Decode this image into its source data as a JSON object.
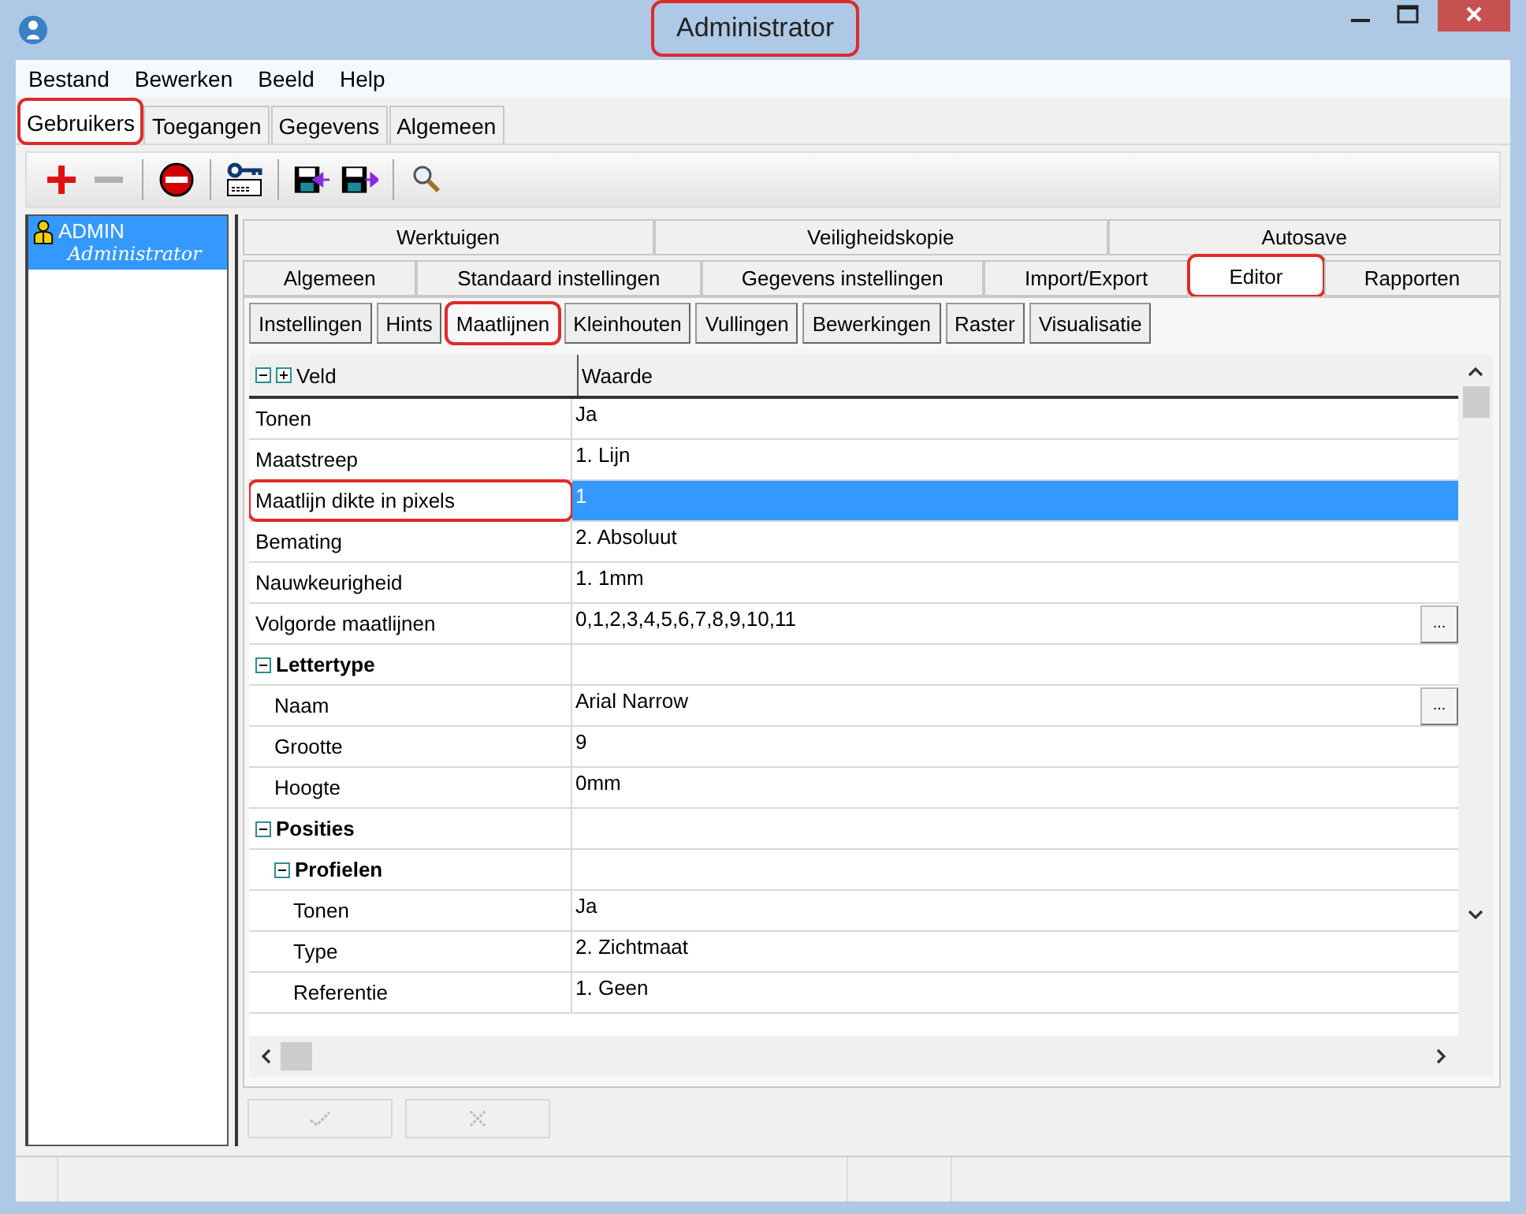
{
  "window": {
    "title": "Administrator",
    "title_highlighted": true
  },
  "menu": [
    "Bestand",
    "Bewerken",
    "Beeld",
    "Help"
  ],
  "top_tabs": [
    {
      "label": "Gebruikers",
      "selected": true,
      "highlighted": true
    },
    {
      "label": "Toegangen",
      "selected": false,
      "highlighted": false
    },
    {
      "label": "Gegevens",
      "selected": false,
      "highlighted": false
    },
    {
      "label": "Algemeen",
      "selected": false,
      "highlighted": false
    }
  ],
  "toolbar": [
    {
      "kind": "add",
      "disabled": false
    },
    {
      "kind": "remove",
      "disabled": true
    },
    {
      "kind": "sep"
    },
    {
      "kind": "block",
      "disabled": false
    },
    {
      "kind": "sep"
    },
    {
      "kind": "password",
      "disabled": false
    },
    {
      "kind": "sep"
    },
    {
      "kind": "import",
      "disabled": false
    },
    {
      "kind": "export",
      "disabled": false
    },
    {
      "kind": "sep"
    },
    {
      "kind": "search",
      "disabled": false
    }
  ],
  "users": [
    {
      "name": "ADMIN",
      "role": "Administrator",
      "selected": true
    }
  ],
  "settings_tabs": [
    [
      {
        "label": "Werktuigen",
        "selected": false,
        "highlighted": false
      },
      {
        "label": "Veiligheidskopie",
        "selected": false,
        "highlighted": false
      },
      {
        "label": "Autosave",
        "selected": false,
        "highlighted": false
      }
    ],
    [
      {
        "label": "Algemeen",
        "selected": false,
        "highlighted": false
      },
      {
        "label": "Standaard instellingen",
        "selected": false,
        "highlighted": false
      },
      {
        "label": "Gegevens instellingen",
        "selected": false,
        "highlighted": false
      },
      {
        "label": "Import/Export",
        "selected": false,
        "highlighted": false
      },
      {
        "label": "Editor",
        "selected": true,
        "highlighted": true
      },
      {
        "label": "Rapporten",
        "selected": false,
        "highlighted": false
      }
    ]
  ],
  "sub_tabs": [
    {
      "label": "Instellingen",
      "selected": false,
      "highlighted": false
    },
    {
      "label": "Hints",
      "selected": false,
      "highlighted": false
    },
    {
      "label": "Maatlijnen",
      "selected": true,
      "highlighted": true
    },
    {
      "label": "Kleinhouten",
      "selected": false,
      "highlighted": false
    },
    {
      "label": "Vullingen",
      "selected": false,
      "highlighted": false
    },
    {
      "label": "Bewerkingen",
      "selected": false,
      "highlighted": false
    },
    {
      "label": "Raster",
      "selected": false,
      "highlighted": false
    },
    {
      "label": "Visualisatie",
      "selected": false,
      "highlighted": false
    }
  ],
  "grid": {
    "columns": [
      "Veld",
      "Waarde"
    ],
    "rows": [
      {
        "kind": "field",
        "name": "Tonen",
        "value": "Ja",
        "selected": false,
        "highlighted": false
      },
      {
        "kind": "field",
        "name": "Maatstreep",
        "value": "1. Lijn",
        "selected": false,
        "highlighted": false
      },
      {
        "kind": "field",
        "name": "Maatlijn dikte in pixels",
        "value": "1",
        "selected": true,
        "highlighted": true
      },
      {
        "kind": "field",
        "name": "Bemating",
        "value": "2. Absoluut",
        "selected": false,
        "highlighted": false
      },
      {
        "kind": "field",
        "name": "Nauwkeurigheid",
        "value": "1. 1mm",
        "selected": false,
        "highlighted": false
      },
      {
        "kind": "field",
        "name": "Volgorde maatlijnen",
        "value": "0,1,2,3,4,5,6,7,8,9,10,11",
        "button": "...",
        "selected": false,
        "highlighted": false
      },
      {
        "kind": "group",
        "name": "Lettertype",
        "expanded": true,
        "children": [
          {
            "kind": "field",
            "name": "Naam",
            "value": "Arial Narrow",
            "button": "...",
            "selected": false,
            "highlighted": false
          },
          {
            "kind": "field",
            "name": "Grootte",
            "value": "9",
            "selected": false,
            "highlighted": false
          },
          {
            "kind": "field",
            "name": "Hoogte",
            "value": "0mm",
            "selected": false,
            "highlighted": false
          }
        ]
      },
      {
        "kind": "group",
        "name": "Posities",
        "expanded": true,
        "children": [
          {
            "kind": "group",
            "name": "Profielen",
            "expanded": true,
            "children": [
              {
                "kind": "field",
                "name": "Tonen",
                "value": "Ja",
                "selected": false,
                "highlighted": false
              },
              {
                "kind": "field",
                "name": "Type",
                "value": "2. Zichtmaat",
                "selected": false,
                "highlighted": false
              },
              {
                "kind": "field",
                "name": "Referentie",
                "value": "1. Geen",
                "selected": false,
                "highlighted": false
              }
            ]
          }
        ]
      }
    ]
  },
  "actions": [
    {
      "kind": "confirm",
      "disabled": true
    },
    {
      "kind": "cancel",
      "disabled": true
    }
  ]
}
